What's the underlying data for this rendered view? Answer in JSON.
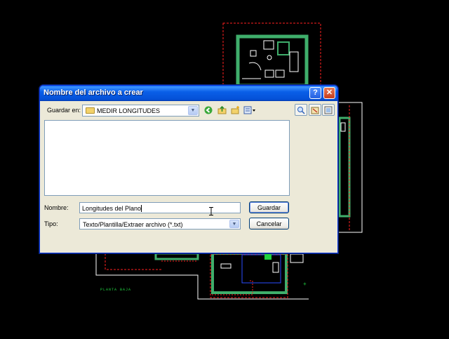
{
  "dialog": {
    "title": "Nombre del archivo a crear",
    "help_glyph": "?",
    "close_glyph": "✕",
    "save_in_label": "Guardar en:",
    "folder_name": "MEDIR LONGITUDES",
    "name_label": "Nombre:",
    "name_value": "Longitudes del Plano",
    "type_label": "Tipo:",
    "type_value": "Texto/Plantilla/Extraer archivo (*.txt)",
    "save_button": "Guardar",
    "cancel_button": "Cancelar"
  },
  "toolbar": {
    "icons": [
      "back-icon",
      "up-folder-icon",
      "new-folder-icon",
      "views-menu-icon",
      "search-web-icon",
      "delete-icon",
      "tools-icon"
    ]
  },
  "background_drawing": {
    "bottom_label": "PLANTA BAJA"
  },
  "colors": {
    "titlebar": "#0a5fe8",
    "dialog_face": "#ece9d8",
    "cad_background": "#000000",
    "wall_green": "#3fae6b",
    "dim_red": "#ff2020"
  }
}
